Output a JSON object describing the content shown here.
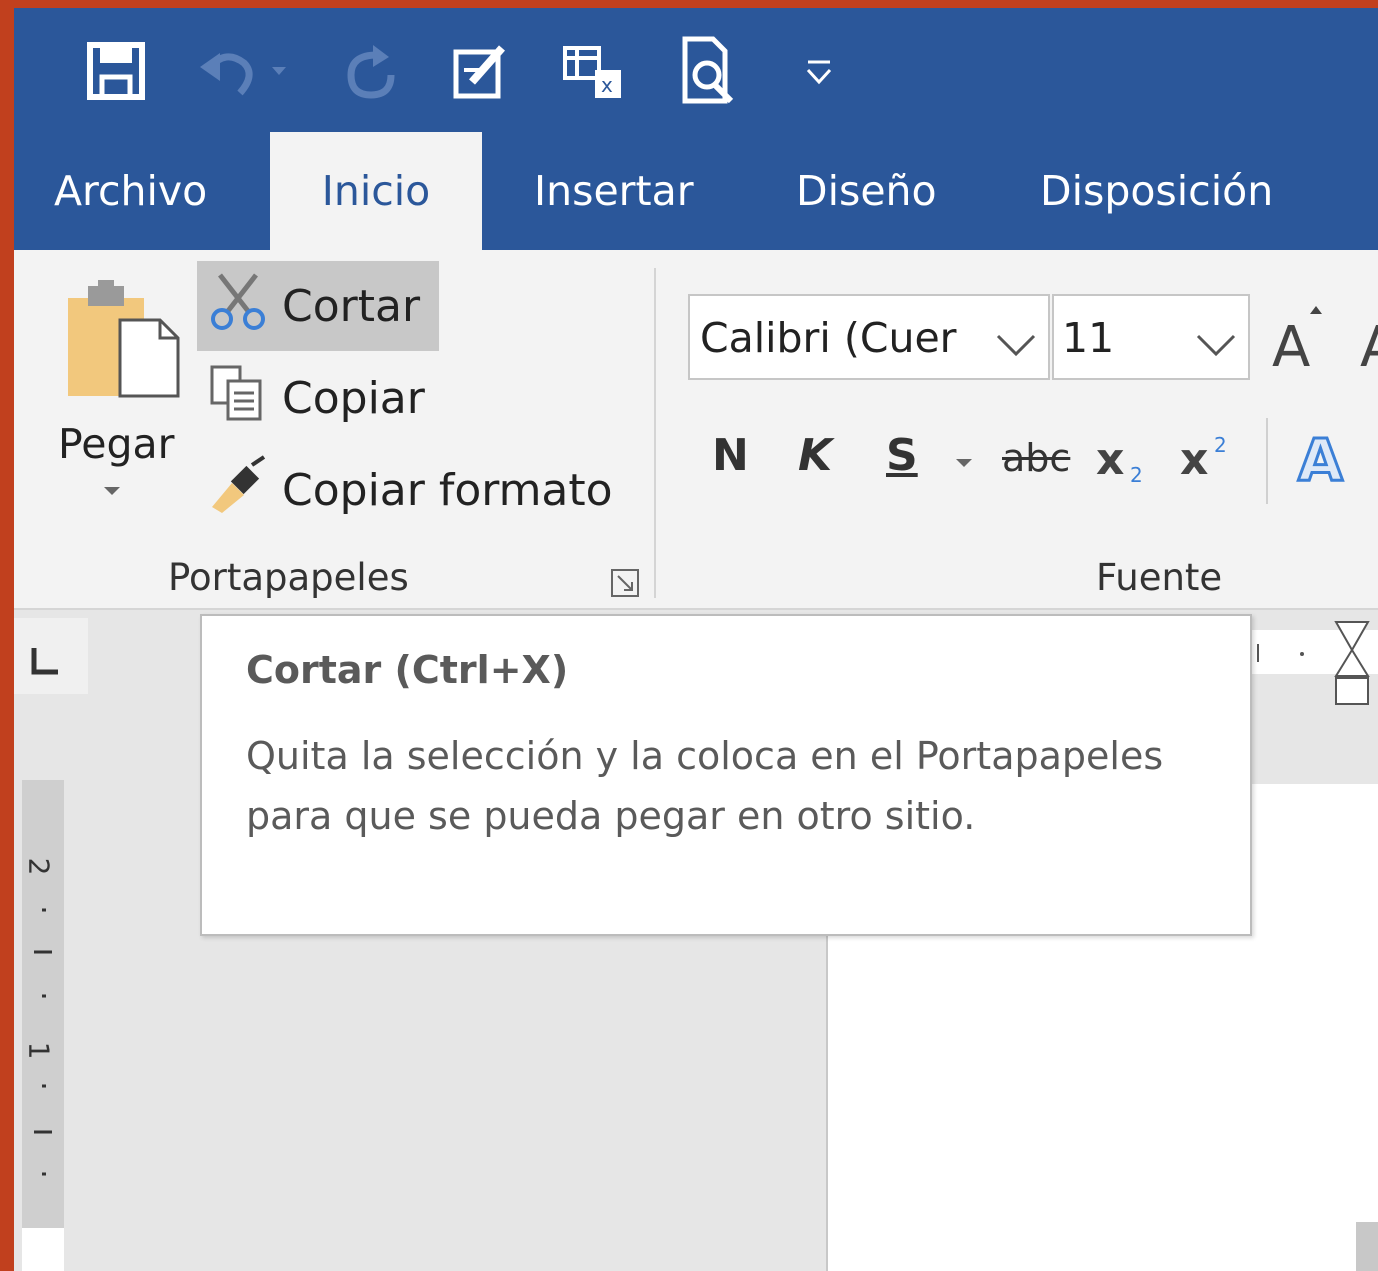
{
  "colors": {
    "brand": "#2b579a",
    "accent_bg": "#c1401e",
    "ribbon": "#f3f3f3"
  },
  "qat": [
    {
      "name": "save-icon"
    },
    {
      "name": "undo-icon"
    },
    {
      "name": "redo-icon"
    },
    {
      "name": "edit-document-icon"
    },
    {
      "name": "table-icon"
    },
    {
      "name": "print-preview-icon"
    },
    {
      "name": "customize-qat-icon"
    }
  ],
  "tabs": [
    {
      "label": "Archivo"
    },
    {
      "label": "Inicio",
      "active": true
    },
    {
      "label": "Insertar"
    },
    {
      "label": "Diseño"
    },
    {
      "label": "Disposición"
    }
  ],
  "clipboard": {
    "paste_label": "Pegar",
    "cut_label": "Cortar",
    "copy_label": "Copiar",
    "format_painter_label": "Copiar formato",
    "group_label": "Portapapeles"
  },
  "font": {
    "font_name": "Calibri (Cuer",
    "font_size": "11",
    "group_label": "Fuente",
    "bold_label": "N",
    "italic_label": "K",
    "underline_label": "S",
    "strike_label": "abc"
  },
  "tooltip": {
    "title": "Cortar (Ctrl+X)",
    "body": "Quita la selección y la coloca en el Portapapeles para que se pueda pegar en otro sitio."
  },
  "ruler": {
    "mark_2": "2",
    "mark_1": "1"
  }
}
